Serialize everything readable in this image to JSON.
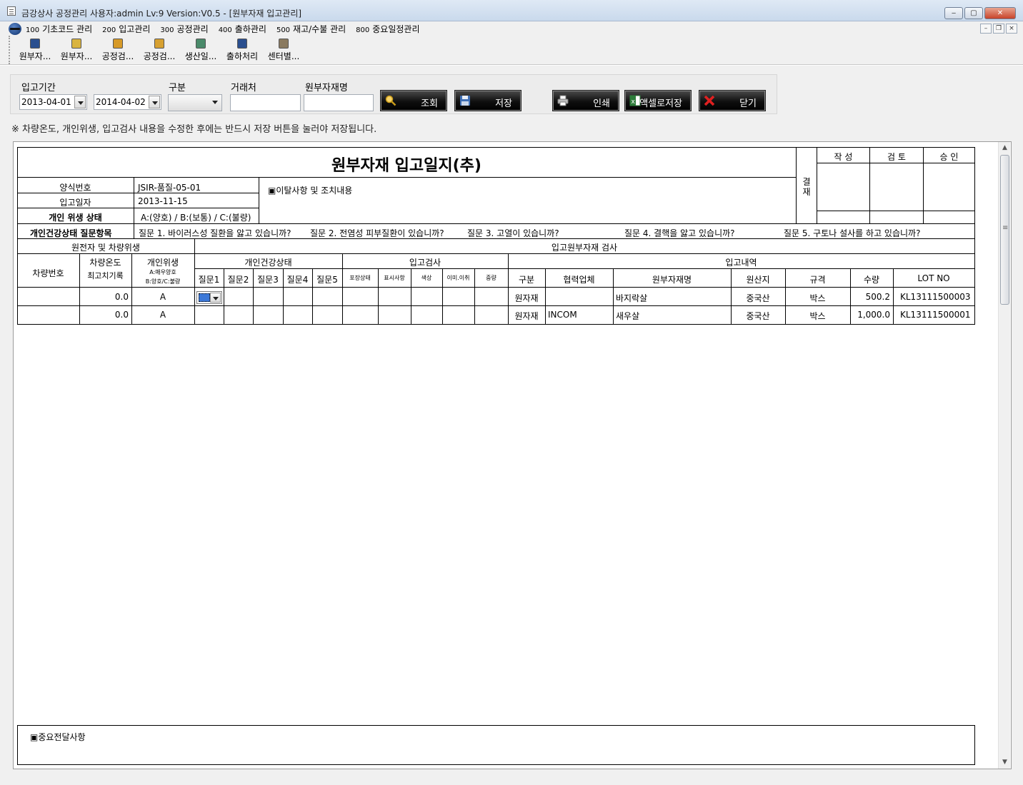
{
  "window": {
    "title": "금강상사 공정관리 사용자:admin Lv:9  Version:V0.5 - [원부자재 입고관리]",
    "minimize": "‒",
    "maximize": "▢",
    "close": "✕"
  },
  "mdi_controls": {
    "minimize": "–",
    "restore": "❐",
    "close": "×"
  },
  "menu": [
    {
      "code": "100",
      "label": "기초코드 관리"
    },
    {
      "code": "200",
      "label": "입고관리"
    },
    {
      "code": "300",
      "label": "공정관리"
    },
    {
      "code": "400",
      "label": "출하관리"
    },
    {
      "code": "500",
      "label": "재고/수불 관리"
    },
    {
      "code": "800",
      "label": "중요일정관리"
    }
  ],
  "toolbar": [
    {
      "label": "원부자...",
      "icon": "login-icon",
      "color": "#2a4f8f"
    },
    {
      "label": "원부자...",
      "icon": "document-icon",
      "color": "#d9b440"
    },
    {
      "label": "공정검...",
      "icon": "box-icon",
      "color": "#d79a28"
    },
    {
      "label": "공정검...",
      "icon": "box-check-icon",
      "color": "#d7a030"
    },
    {
      "label": "생산일...",
      "icon": "calendar-icon",
      "color": "#4a8a6a"
    },
    {
      "label": "출하처리",
      "icon": "logout-icon",
      "color": "#2a4f8f"
    },
    {
      "label": "센터별...",
      "icon": "layers-icon",
      "color": "#8a7a60"
    }
  ],
  "search": {
    "period_label": "입고기간",
    "date_from": "2013-04-01",
    "date_to": "2014-04-02",
    "category_label": "구분",
    "category_value": "",
    "vendor_label": "거래처",
    "vendor_value": "",
    "material_label": "원부자재명",
    "material_value": "",
    "buttons": {
      "search": "조회",
      "save": "저장",
      "print": "인쇄",
      "excel": "액셀로저장",
      "close": "닫기"
    }
  },
  "notice": "※ 차량온도, 개인위생, 입고검사 내용을 수정한 후에는 반드시 저장 버튼을 눌러야 저장됩니다.",
  "report": {
    "title": "원부자재 입고일지(추)",
    "approval": {
      "label": "결\n재",
      "label_1": "결",
      "label_2": "재",
      "columns": [
        "작 성",
        "검 토",
        "승 인"
      ]
    },
    "form_no_label": "양식번호",
    "form_no": "JSIR-품질-05-01",
    "date_label": "입고일자",
    "date": "2013-11-15",
    "hygiene_label": "개인 위생 상태",
    "hygiene_legend": "A:(양호) / B:(보통) / C:(불량)",
    "deviation_label": "▣이탈사항 및 조치내용",
    "health_q_label": "개인건강상태 질문항목",
    "questions": [
      "질문 1. 바이러스성 질환을 앓고 있습니까?",
      "질문 2. 전염성 피부질환이 있습니까?",
      "질문 3. 고열이 있습니까?",
      "질문 4. 결핵을 앓고 있습니까?",
      "질문 5. 구토나 설사를 하고 있습니까?"
    ],
    "group_headers": {
      "driver": "원전자 및 차량위생",
      "inspection": "입고원부자재 검사",
      "health": "개인건강상태",
      "incoming_check": "입고검사",
      "incoming_detail": "입고내역"
    },
    "columns": {
      "vehicle_no": "차량번호",
      "temp_1": "차량온도",
      "temp_2": "최고치기록",
      "hygiene_1": "개인위생",
      "hygiene_2": "A:매우양호",
      "hygiene_3": "B:양호/C:불량",
      "q1": "질문1",
      "q2": "질문2",
      "q3": "질문3",
      "q4": "질문4",
      "q5": "질문5",
      "pack": "포장상태",
      "label": "표시사항",
      "color": "색상",
      "foreign": "이미.이취",
      "weight": "중량",
      "type": "구분",
      "partner": "협력업체",
      "material": "원부자재명",
      "origin": "원산지",
      "spec": "규격",
      "qty": "수량",
      "lot": "LOT NO"
    },
    "rows": [
      {
        "vehicle": "",
        "temp": "0.0",
        "hygiene": "A",
        "type": "원자재",
        "partner": "",
        "material": "바지락살",
        "origin": "중국산",
        "spec": "박스",
        "qty": "500.2",
        "lot": "KL13111500003"
      },
      {
        "vehicle": "",
        "temp": "0.0",
        "hygiene": "A",
        "type": "원자재",
        "partner": "INCOM",
        "material": "새우살",
        "origin": "중국산",
        "spec": "박스",
        "qty": "1,000.0",
        "lot": "KL13111500001"
      }
    ],
    "important_label": "▣중요전달사항"
  },
  "scrollbar": {
    "up": "▲",
    "down": "▼"
  }
}
